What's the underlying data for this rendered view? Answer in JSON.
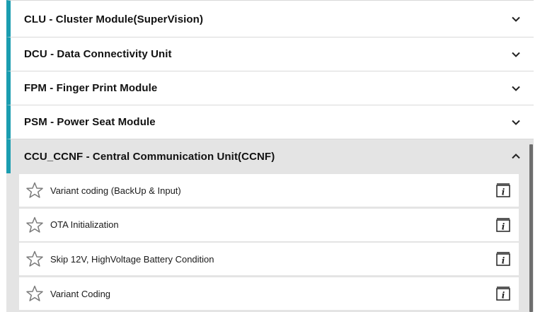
{
  "modules": [
    {
      "label": "CLU - Cluster Module(SuperVision)",
      "expanded": false
    },
    {
      "label": "DCU - Data Connectivity Unit",
      "expanded": false
    },
    {
      "label": "FPM - Finger Print Module",
      "expanded": false
    },
    {
      "label": "PSM - Power Seat Module",
      "expanded": false
    },
    {
      "label": "CCU_CCNF - Central Communication Unit(CCNF)",
      "expanded": true
    }
  ],
  "ccu_items": [
    {
      "label": "Variant coding (BackUp & Input)"
    },
    {
      "label": "OTA Initialization"
    },
    {
      "label": "Skip 12V, HighVoltage Battery Condition"
    },
    {
      "label": "Variant Coding"
    }
  ],
  "colors": {
    "accent": "#1a9db0",
    "expanded_bg": "#e4e4e4",
    "scrollbar": "#6e6e6e"
  },
  "icons": {
    "collapsed": "chevron-down-icon",
    "expanded": "chevron-up-icon",
    "favorite": "star-outline-icon",
    "info": "info-icon"
  }
}
